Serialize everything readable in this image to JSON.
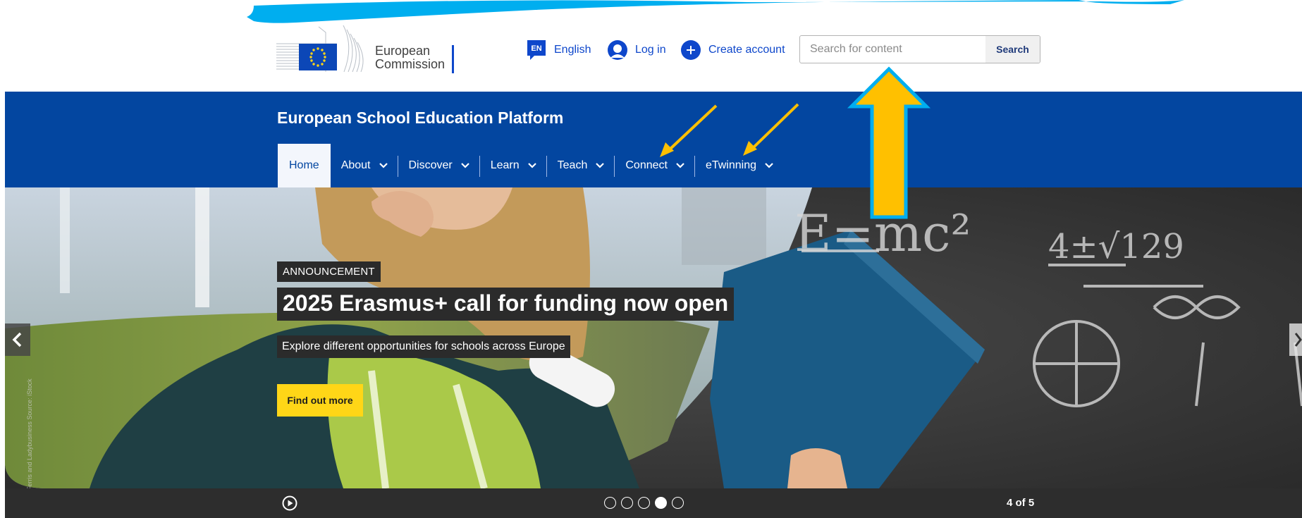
{
  "header": {
    "logo_line1": "European",
    "logo_line2": "Commission",
    "language_code": "EN",
    "language_label": "English",
    "login_label": "Log in",
    "create_account_label": "Create account",
    "search_placeholder": "Search for content",
    "search_button_label": "Search"
  },
  "band": {
    "site_title": "European School Education Platform",
    "nav": [
      {
        "label": "Home",
        "active": true
      },
      {
        "label": "About"
      },
      {
        "label": "Discover"
      },
      {
        "label": "Learn"
      },
      {
        "label": "Teach"
      },
      {
        "label": "Connect"
      },
      {
        "label": "eTwinning"
      }
    ]
  },
  "hero": {
    "tag": "ANNOUNCEMENT",
    "headline": "2025 Erasmus+ call for funding now open",
    "subline": "Explore different opportunities for schools across Europe",
    "cta_label": "Find out more",
    "image_credit": "Ferris and Ladybusiness Source: iStock",
    "chalk_formula": "E=mc²",
    "chalk_fraction": "4±√129"
  },
  "carousel": {
    "total_slides": 5,
    "current_slide": 4,
    "counter_label": "4 of 5"
  },
  "colors": {
    "brand_blue": "#0346a0",
    "link_blue": "#0e47cb",
    "cta_yellow": "#ffd617",
    "annotation_yellow": "#ffc000",
    "annotation_cyan": "#00aeef"
  }
}
